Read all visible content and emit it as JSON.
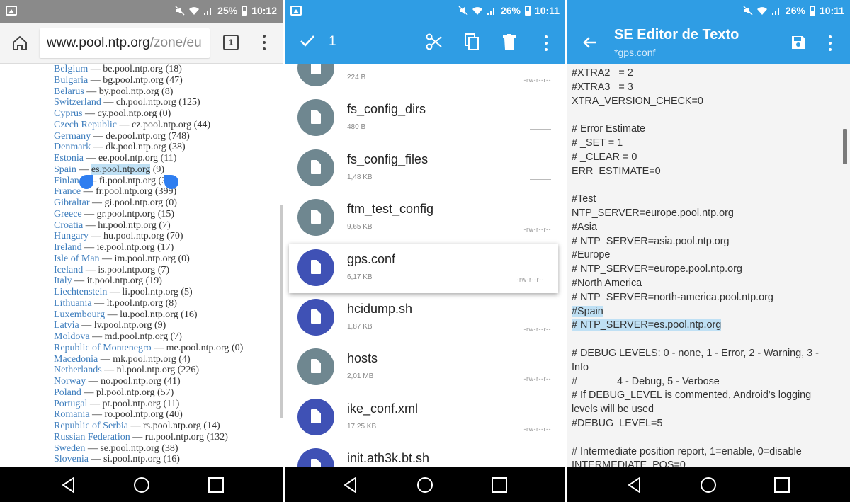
{
  "colors": {
    "browser_status": "#8a8a8a",
    "app_blue": "#2f9de4",
    "file_icon_grey": "#6f8790",
    "file_icon_blue": "#3f51b5",
    "link_blue": "#3d7dbd",
    "highlight": "#bfe0f4"
  },
  "browser": {
    "status": {
      "battery": "25%",
      "time": "10:12"
    },
    "url_host": "www.pool.ntp.org",
    "url_path": "/zone/eu",
    "tab_count": "1",
    "countries": [
      {
        "name": "Belgium",
        "host": "be.pool.ntp.org",
        "count": "(18)"
      },
      {
        "name": "Bulgaria",
        "host": "bg.pool.ntp.org",
        "count": "(47)"
      },
      {
        "name": "Belarus",
        "host": "by.pool.ntp.org",
        "count": "(8)"
      },
      {
        "name": "Switzerland",
        "host": "ch.pool.ntp.org",
        "count": "(125)"
      },
      {
        "name": "Cyprus",
        "host": "cy.pool.ntp.org",
        "count": "(0)"
      },
      {
        "name": "Czech Republic",
        "host": "cz.pool.ntp.org",
        "count": "(44)"
      },
      {
        "name": "Germany",
        "host": "de.pool.ntp.org",
        "count": "(748)"
      },
      {
        "name": "Denmark",
        "host": "dk.pool.ntp.org",
        "count": "(38)"
      },
      {
        "name": "Estonia",
        "host": "ee.pool.ntp.org",
        "count": "(11)"
      },
      {
        "name": "Spain",
        "host": "es.pool.ntp.org",
        "count": "(9)"
      },
      {
        "name": "Finland",
        "host": "fi.pool.ntp.org",
        "count": "(39)"
      },
      {
        "name": "France",
        "host": "fr.pool.ntp.org",
        "count": "(399)"
      },
      {
        "name": "Gibraltar",
        "host": "gi.pool.ntp.org",
        "count": "(0)"
      },
      {
        "name": "Greece",
        "host": "gr.pool.ntp.org",
        "count": "(15)"
      },
      {
        "name": "Croatia",
        "host": "hr.pool.ntp.org",
        "count": "(7)"
      },
      {
        "name": "Hungary",
        "host": "hu.pool.ntp.org",
        "count": "(70)"
      },
      {
        "name": "Ireland",
        "host": "ie.pool.ntp.org",
        "count": "(17)"
      },
      {
        "name": "Isle of Man",
        "host": "im.pool.ntp.org",
        "count": "(0)"
      },
      {
        "name": "Iceland",
        "host": "is.pool.ntp.org",
        "count": "(7)"
      },
      {
        "name": "Italy",
        "host": "it.pool.ntp.org",
        "count": "(19)"
      },
      {
        "name": "Liechtenstein",
        "host": "li.pool.ntp.org",
        "count": "(5)"
      },
      {
        "name": "Lithuania",
        "host": "lt.pool.ntp.org",
        "count": "(8)"
      },
      {
        "name": "Luxembourg",
        "host": "lu.pool.ntp.org",
        "count": "(16)"
      },
      {
        "name": "Latvia",
        "host": "lv.pool.ntp.org",
        "count": "(9)"
      },
      {
        "name": "Moldova",
        "host": "md.pool.ntp.org",
        "count": "(7)"
      },
      {
        "name": "Republic of Montenegro",
        "host": "me.pool.ntp.org",
        "count": "(0)"
      },
      {
        "name": "Macedonia",
        "host": "mk.pool.ntp.org",
        "count": "(4)"
      },
      {
        "name": "Netherlands",
        "host": "nl.pool.ntp.org",
        "count": "(226)"
      },
      {
        "name": "Norway",
        "host": "no.pool.ntp.org",
        "count": "(41)"
      },
      {
        "name": "Poland",
        "host": "pl.pool.ntp.org",
        "count": "(57)"
      },
      {
        "name": "Portugal",
        "host": "pt.pool.ntp.org",
        "count": "(11)"
      },
      {
        "name": "Romania",
        "host": "ro.pool.ntp.org",
        "count": "(40)"
      },
      {
        "name": "Republic of Serbia",
        "host": "rs.pool.ntp.org",
        "count": "(14)"
      },
      {
        "name": "Russian Federation",
        "host": "ru.pool.ntp.org",
        "count": "(132)"
      },
      {
        "name": "Sweden",
        "host": "se.pool.ntp.org",
        "count": "(38)"
      },
      {
        "name": "Slovenia",
        "host": "si.pool.ntp.org",
        "count": "(16)"
      }
    ],
    "selected_index": 9
  },
  "file_manager": {
    "status": {
      "battery": "26%",
      "time": "10:11"
    },
    "selection_count": "1",
    "files": [
      {
        "name": "",
        "size": "224 B",
        "perm": "-rw-r--r--",
        "blue": false
      },
      {
        "name": "fs_config_dirs",
        "size": "480 B",
        "perm": "",
        "blue": false
      },
      {
        "name": "fs_config_files",
        "size": "1,48 KB",
        "perm": "",
        "blue": false
      },
      {
        "name": "ftm_test_config",
        "size": "9,65 KB",
        "perm": "-rw-r--r--",
        "blue": false
      },
      {
        "name": "gps.conf",
        "size": "6,17 KB",
        "perm": "-rw-r--r--",
        "blue": true
      },
      {
        "name": "hcidump.sh",
        "size": "1,87 KB",
        "perm": "-rw-r--r--",
        "blue": true
      },
      {
        "name": "hosts",
        "size": "2,01 MB",
        "perm": "-rw-r--r--",
        "blue": false
      },
      {
        "name": "ike_conf.xml",
        "size": "17,25 KB",
        "perm": "-rw-r--r--",
        "blue": true
      },
      {
        "name": "init.ath3k.bt.sh",
        "size": "",
        "perm": "",
        "blue": true
      }
    ],
    "selected_index": 4
  },
  "editor": {
    "status": {
      "battery": "26%",
      "time": "10:11"
    },
    "title": "SE Editor de Texto",
    "filename": "*gps.conf",
    "lines": [
      "#XTRA2   = 2",
      "#XTRA3   = 3",
      "XTRA_VERSION_CHECK=0",
      "",
      "# Error Estimate",
      "# _SET = 1",
      "# _CLEAR = 0",
      "ERR_ESTIMATE=0",
      "",
      "#Test",
      "NTP_SERVER=europe.pool.ntp.org",
      "#Asia",
      "# NTP_SERVER=asia.pool.ntp.org",
      "#Europe",
      "# NTP_SERVER=europe.pool.ntp.org",
      "#North America",
      "# NTP_SERVER=north-america.pool.ntp.org",
      "#Spain",
      "# NTP_SERVER=es.pool.ntp.org",
      "",
      "# DEBUG LEVELS: 0 - none, 1 - Error, 2 - Warning, 3 -",
      "Info",
      "#              4 - Debug, 5 - Verbose",
      "# If DEBUG_LEVEL is commented, Android's logging",
      "levels will be used",
      "#DEBUG_LEVEL=5",
      "",
      "# Intermediate position report, 1=enable, 0=disable",
      "INTERMEDIATE_POS=0"
    ],
    "highlighted_lines": [
      17,
      18
    ]
  },
  "icons": {
    "status": [
      "gallery-icon",
      "mute-icon",
      "wifi-icon",
      "signal-icon",
      "battery-icon"
    ],
    "browser": [
      "home-icon",
      "tabs-icon",
      "overflow-menu-icon"
    ],
    "file_manager": [
      "check-icon",
      "cut-icon",
      "copy-icon",
      "delete-icon",
      "overflow-menu-icon"
    ],
    "editor": [
      "back-arrow-icon",
      "save-icon",
      "overflow-menu-icon"
    ],
    "nav": [
      "back-triangle-icon",
      "home-circle-icon",
      "recents-square-icon"
    ]
  }
}
